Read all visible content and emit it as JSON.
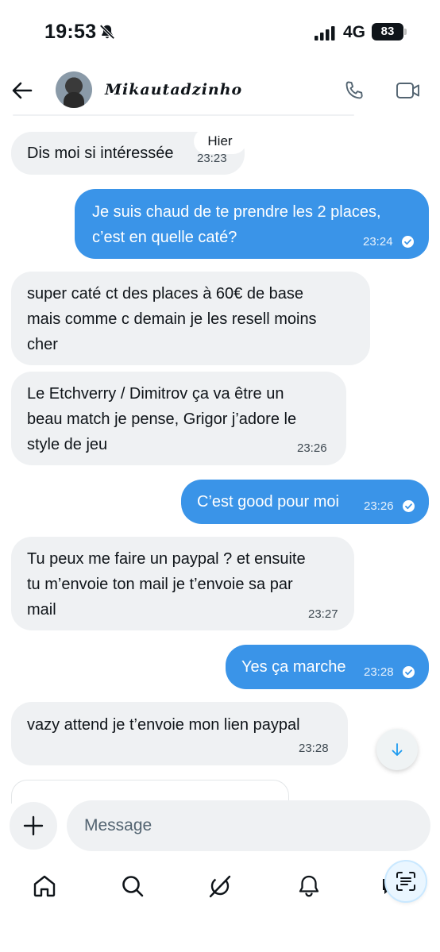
{
  "status_bar": {
    "time": "19:53",
    "network": "4G",
    "battery": "83"
  },
  "header": {
    "contact_name": "Mikautadzinho"
  },
  "day_separator": "Hier",
  "messages": [
    {
      "direction": "incoming",
      "text": "Dis moi si intéressée",
      "time": "23:23"
    },
    {
      "direction": "outgoing",
      "text": "Je suis chaud de te prendre les 2 places,\nc’est en quelle caté?",
      "time": "23:24",
      "read": true
    },
    {
      "direction": "incoming",
      "text": "super caté ct des places à 60€ de base\nmais comme c demain je les resell moins\ncher",
      "time": ""
    },
    {
      "direction": "incoming",
      "text": "Le Etchverry / Dimitrov ça va être un\nbeau match je pense, Grigor j’adore le\nstyle de jeu",
      "time": "23:26"
    },
    {
      "direction": "outgoing",
      "text": "C’est good pour moi",
      "time": "23:26",
      "read": true
    },
    {
      "direction": "incoming",
      "text": "Tu peux me faire un paypal ? et ensuite\ntu m’envoie ton mail je t’envoie sa par\nmail",
      "time": "23:27"
    },
    {
      "direction": "outgoing",
      "text": "Yes ça marche",
      "time": "23:28",
      "read": true
    },
    {
      "direction": "incoming",
      "text": "vazy attend je t’envoie mon lien paypal",
      "time": "23:28"
    }
  ],
  "composer": {
    "placeholder": "Message"
  },
  "nav": [
    "home-icon",
    "search-icon",
    "grok-icon",
    "notifications-icon",
    "messages-icon"
  ],
  "colors": {
    "outgoing_bubble": "#3a94e8",
    "incoming_bubble": "#eff1f3"
  }
}
